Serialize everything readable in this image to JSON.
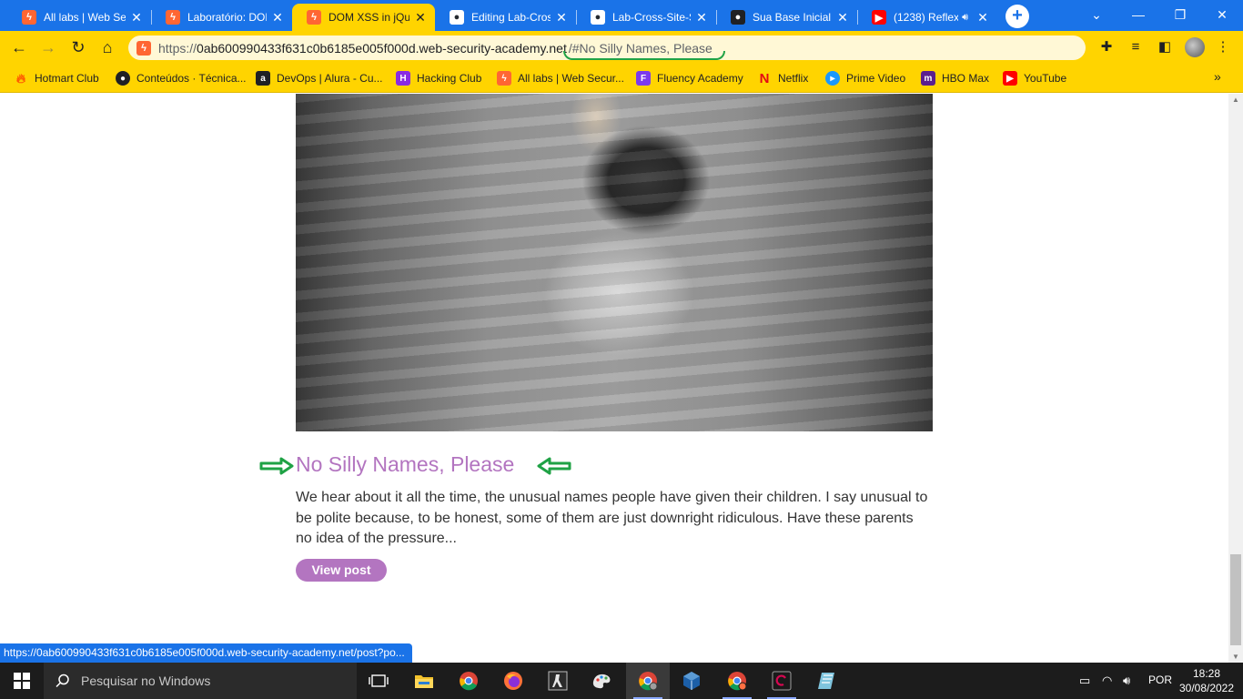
{
  "tabs": [
    {
      "title": "All labs | Web Sec",
      "icon": "burp-icon"
    },
    {
      "title": "Laboratório: DOM",
      "icon": "burp-icon"
    },
    {
      "title": "DOM XSS in jQue",
      "icon": "burp-icon",
      "active": true
    },
    {
      "title": "Editing Lab-Cross",
      "icon": "github-icon"
    },
    {
      "title": "Lab-Cross-Site-S",
      "icon": "github-icon"
    },
    {
      "title": "Sua Base Inicial",
      "icon": "base-icon"
    },
    {
      "title": "(1238) Reflex",
      "icon": "youtube-icon"
    }
  ],
  "address_bar": {
    "url_proto": "https://",
    "url_host": "0ab600990433f631c0b6185e005f000d.web-security-academy.net",
    "url_fragment": "/#No Silly Names, Please"
  },
  "bookmarks": [
    {
      "label": "Hotmart Club",
      "icon": "hotmart-icon"
    },
    {
      "label": "Conteúdos · Técnica...",
      "icon": "conteudos-icon"
    },
    {
      "label": "DevOps | Alura - Cu...",
      "icon": "alura-icon"
    },
    {
      "label": "Hacking Club",
      "icon": "hacking-club-icon"
    },
    {
      "label": "All labs | Web Secur...",
      "icon": "burp-icon"
    },
    {
      "label": "Fluency Academy",
      "icon": "fluency-icon"
    },
    {
      "label": "Netflix",
      "icon": "netflix-icon"
    },
    {
      "label": "Prime Video",
      "icon": "prime-video-icon"
    },
    {
      "label": "HBO Max",
      "icon": "hbo-max-icon"
    },
    {
      "label": "YouTube",
      "icon": "youtube-icon"
    }
  ],
  "post": {
    "title": "No Silly Names, Please",
    "summary": "We hear about it all the time, the unusual names people have given their children. I say unusual to be polite because, to be honest, some of them are just downright ridiculous. Have these parents no idea of the pressure...",
    "button_label": "View post"
  },
  "status_bar": {
    "link": "https://0ab600990433f631c0b6185e005f000d.web-security-academy.net/post?po..."
  },
  "taskbar": {
    "search_placeholder": "Pesquisar no Windows",
    "language": "POR",
    "time": "18:28",
    "date": "30/08/2022"
  },
  "colors": {
    "browser_frame": "#1a73e8",
    "toolbar": "#ffd400",
    "post_accent": "#b375c0",
    "annotation": "#1fa245"
  }
}
